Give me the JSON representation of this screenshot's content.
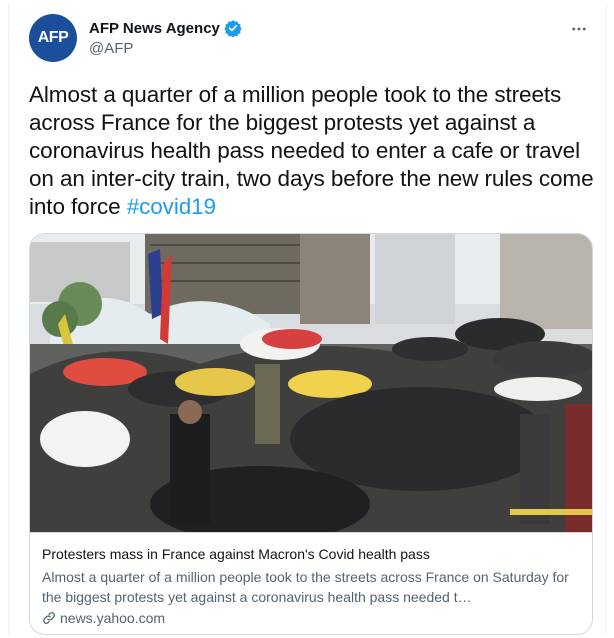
{
  "author": {
    "avatar_text": "AFP",
    "name": "AFP News Agency",
    "handle": "@AFP"
  },
  "tweet": {
    "text": "Almost a quarter of a million people took to the streets across France for the biggest protests yet against a coronavirus health pass needed to enter a cafe or travel on an inter-city train, two days before the new rules come into force ",
    "hashtag": "#covid19"
  },
  "card": {
    "title": "Protesters mass in France against Macron's Covid health pass",
    "description": "Almost a quarter of a million people took to the streets across France on Saturday for the biggest protests yet against a coronavirus health pass needed t…",
    "domain": "news.yahoo.com"
  },
  "colors": {
    "accent": "#1d9bf0",
    "avatar_bg": "#1b4f9c",
    "muted_text": "#536471"
  },
  "icons": [
    "verified-icon",
    "more-icon",
    "link-icon"
  ]
}
